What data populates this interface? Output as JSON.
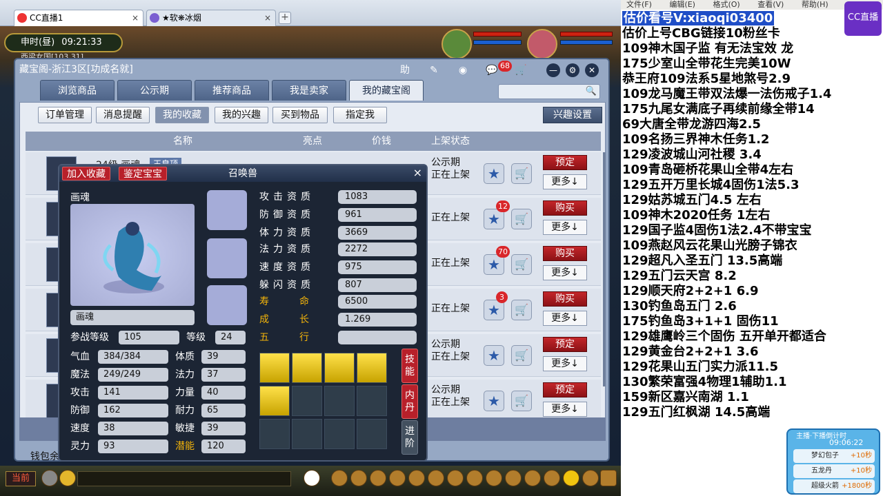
{
  "browser": {
    "tabs": [
      {
        "label": "CC直播1",
        "close": "×"
      },
      {
        "label": "★软❋冰烟",
        "close": "×"
      }
    ],
    "add": "+"
  },
  "game": {
    "time_prefix": "申时(昼)",
    "time": "09:21:33",
    "map_text": "西梁女国[103,31]",
    "current_channel": "当前"
  },
  "window": {
    "title": "藏宝阁-浙江3区[功成名就]",
    "help": "助",
    "badge": "68",
    "tabs": [
      "浏览商品",
      "公示期",
      "推荐商品",
      "我是卖家",
      "我的藏宝阁"
    ],
    "sub_buttons": [
      "订单管理",
      "消息提醒",
      "我的收藏",
      "我的兴趣",
      "买到物品",
      "指定我"
    ],
    "interest_button": "兴趣设置",
    "headers": {
      "name": "名称",
      "highlight": "亮点",
      "price": "价钱",
      "status": "上架状态"
    },
    "first_row": {
      "level": "24级",
      "type": "画魂",
      "tag": "王皇顶"
    },
    "rows": [
      {
        "status": "公示期\n正在上架",
        "badge": "",
        "action": "预定",
        "more": "更多↓"
      },
      {
        "status": "正在上架",
        "badge": "12",
        "action": "购买",
        "more": "更多↓"
      },
      {
        "status": "正在上架",
        "badge": "70",
        "action": "购买",
        "more": "更多↓"
      },
      {
        "status": "正在上架",
        "badge": "3",
        "action": "购买",
        "more": "更多↓"
      },
      {
        "status": "公示期\n正在上架",
        "badge": "",
        "action": "预定",
        "more": "更多↓"
      },
      {
        "status": "公示期\n正在上架",
        "badge": "",
        "action": "预定",
        "more": "更多↓"
      }
    ],
    "wallet": "钱包余"
  },
  "popup": {
    "title": "召唤兽",
    "add_fav": "加入收藏",
    "identify": "鉴定宝宝",
    "close": "×",
    "pet_name": "画魂",
    "name_value": "画魂",
    "level_label": "参战等级",
    "level_value": "105",
    "grade_label": "等级",
    "grade_value": "24",
    "stats_left": [
      {
        "label": "气血",
        "value": "384/384"
      },
      {
        "label": "魔法",
        "value": "249/249"
      },
      {
        "label": "攻击",
        "value": "141"
      },
      {
        "label": "防御",
        "value": "162"
      },
      {
        "label": "速度",
        "value": "38"
      },
      {
        "label": "灵力",
        "value": "93"
      }
    ],
    "stats_right": [
      {
        "label": "体质",
        "value": "39"
      },
      {
        "label": "法力",
        "value": "37"
      },
      {
        "label": "力量",
        "value": "40"
      },
      {
        "label": "耐力",
        "value": "65"
      },
      {
        "label": "敏捷",
        "value": "39"
      },
      {
        "label": "潜能",
        "value": "120"
      }
    ],
    "aptitudes": [
      {
        "label": "攻击资质",
        "value": "1083"
      },
      {
        "label": "防御资质",
        "value": "961"
      },
      {
        "label": "体力资质",
        "value": "3669"
      },
      {
        "label": "法力资质",
        "value": "2272"
      },
      {
        "label": "速度资质",
        "value": "975"
      },
      {
        "label": "躲闪资质",
        "value": "807"
      },
      {
        "label": "寿命",
        "value": "6500"
      },
      {
        "label": "成长",
        "value": "1.269"
      },
      {
        "label": "五行",
        "value": ""
      }
    ],
    "side_tabs": [
      "技能",
      "内丹",
      "进阶"
    ]
  },
  "right_panel": {
    "menu": [
      "文件(F)",
      "编辑(E)",
      "格式(O)",
      "查看(V)",
      "帮助(H)"
    ],
    "logo": "CC直播",
    "lines": [
      "估价看号V:xiaoqi03400",
      "估价上号CBG链接10粉丝卡",
      "109神木国子监  有无法宝效  龙",
      "175少室山全带花生完美10W",
      "恭王府109法系5星地煞号2.9",
      "109龙马魔王带双法爆一法伤戒子1.4",
      "175九尾女满底子再续前缘全带14",
      "69大唐全带龙游四海2.5",
      "109名扬三界神木任务1.2",
      "129凌波城山河社稷  3.4",
      "109青岛砸桥花果山全带4左右",
      "129五开万里长城4固伤1法5.3",
      "129姑苏城五门4.5 左右",
      "109神木2020任务  1左右",
      "129国子监4固伤1法2.4不带宝宝",
      "109燕赵风云花果山光膀子锦衣",
      "129超凡入圣五门  13.5高端",
      "129五门云天宫 8.2",
      "129顺天府2+2+1  6.9",
      "130钓鱼岛五门  2.6",
      "175钓鱼岛3+1+1 固伤11",
      "129雄鹰岭三个固伤 五开单开都适合",
      "129黄金台2+2+1 3.6",
      "129花果山五门实力派11.5",
      "130繁荣富强4物理1辅助1.1",
      "159新区嘉兴南湖  1.1",
      "129五门红枫湖 14.5高端"
    ],
    "widget": {
      "title": "主播·下播倒计时",
      "clock": "09:06:22",
      "items": [
        {
          "name": "梦幻包子",
          "value": "+10秒"
        },
        {
          "name": "五龙丹",
          "value": "+10秒"
        },
        {
          "name": "超级火箭",
          "value": "+1800秒"
        }
      ]
    }
  },
  "colors": {
    "accent_red": "#b8202a",
    "window_blue": "#96a8c4",
    "highlight_blue": "#1f4ec7"
  }
}
